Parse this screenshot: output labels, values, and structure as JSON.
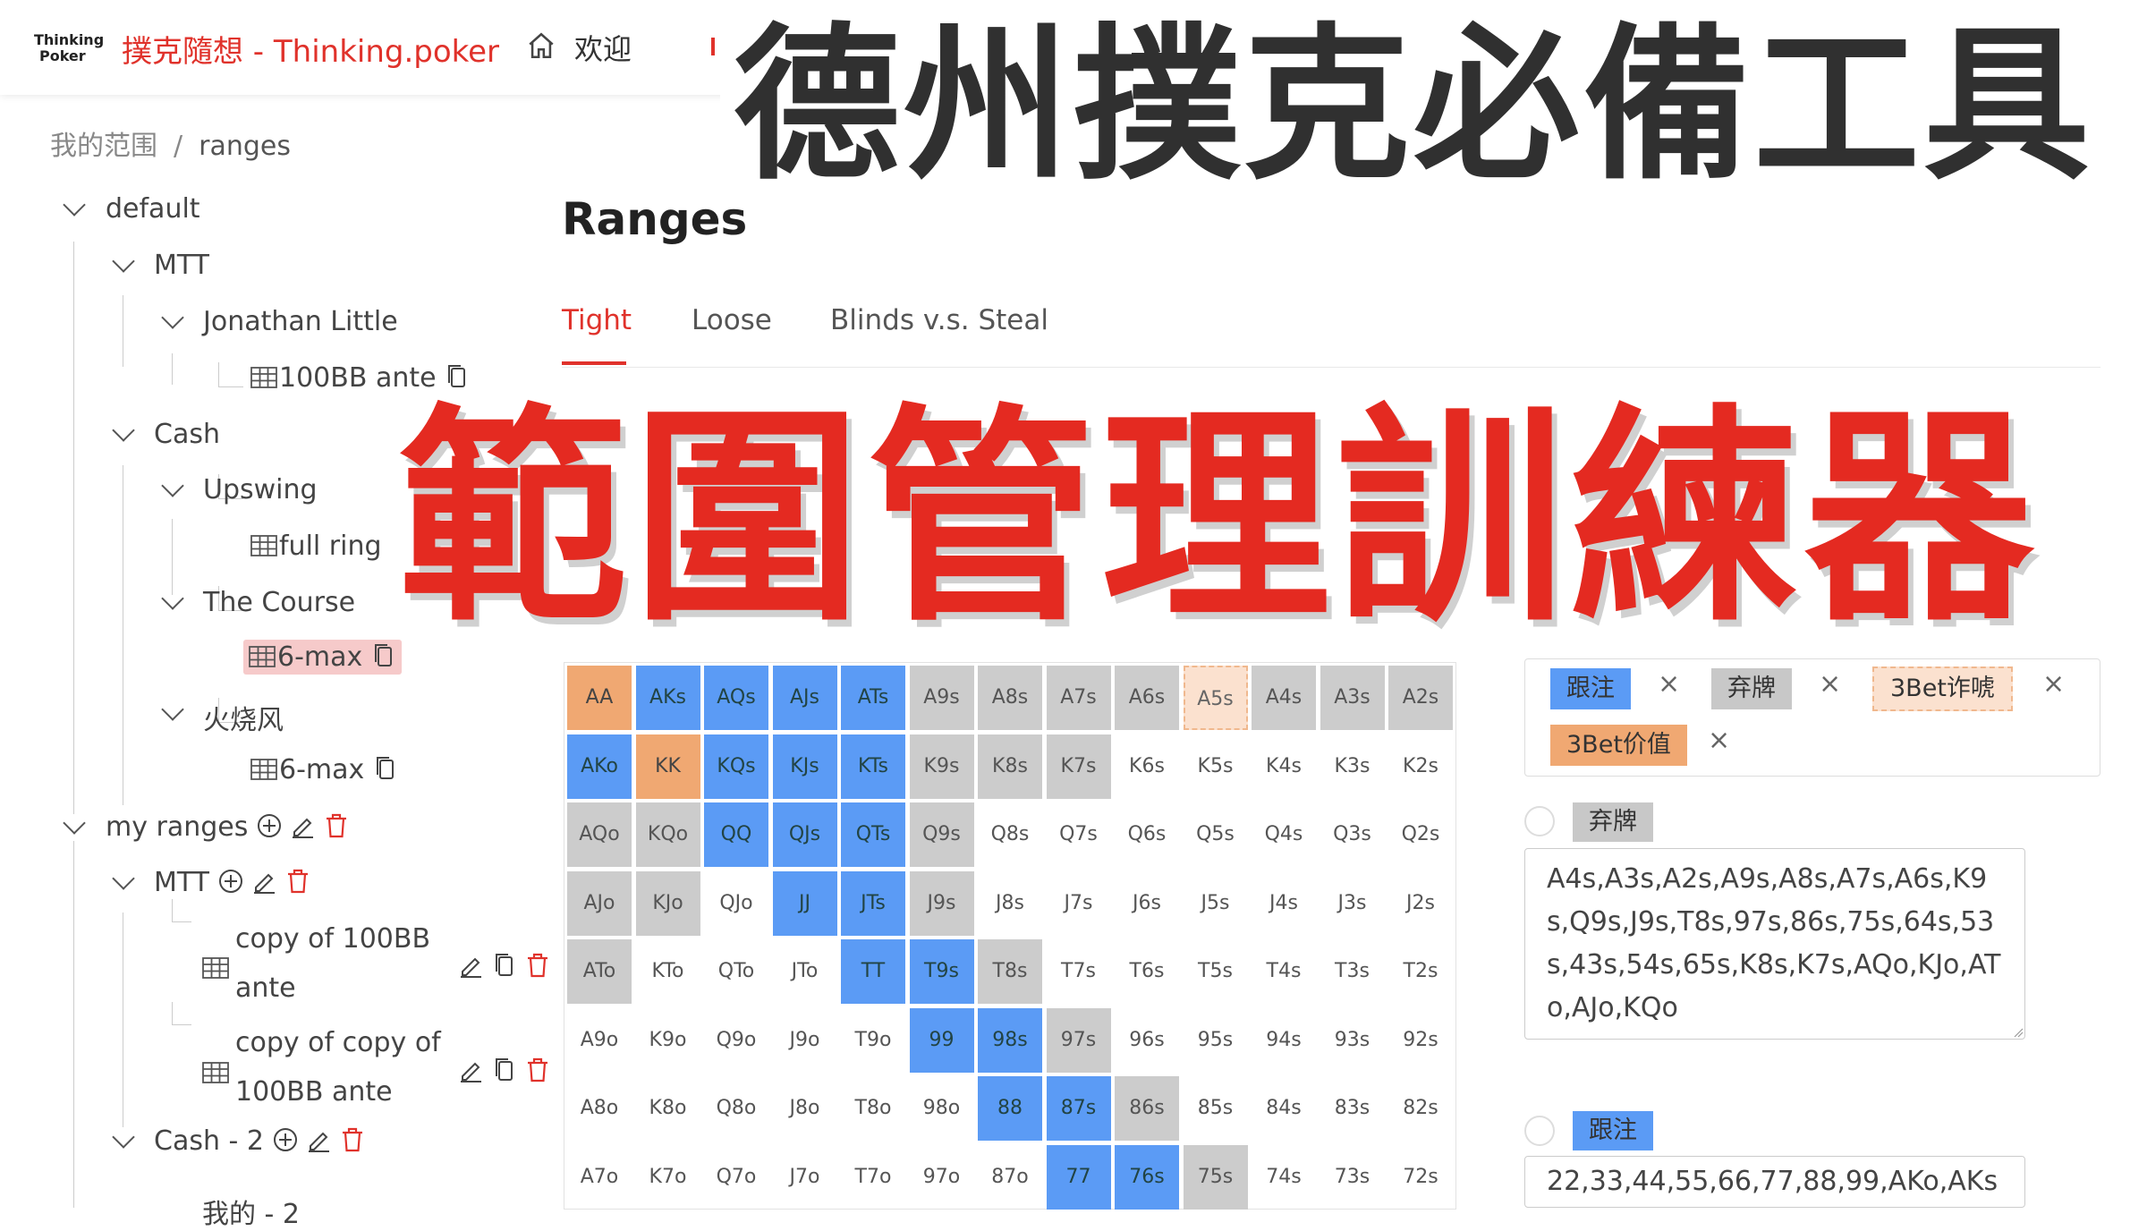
{
  "header": {
    "logo_line1": "Thinking",
    "logo_line2": "Poker",
    "title": "撲克隨想 - Thinking.poker",
    "nav_welcome": "欢迎"
  },
  "breadcrumb": {
    "root": "我的范围",
    "sep": "/",
    "current": "ranges"
  },
  "tree": {
    "default": "default",
    "mtt": "MTT",
    "jonathan": "Jonathan Little",
    "ante100": "100BB ante",
    "cash": "Cash",
    "upswing": "Upswing",
    "fullring": "full ring",
    "course": "The Course",
    "sixmax1": "6-max",
    "huoshao": "火烧风",
    "sixmax2": "6-max",
    "myranges": "my ranges",
    "mtt2": "MTT",
    "copy1_l1": "copy of 100BB",
    "copy1_l2": "ante",
    "copy2_l1": "copy of copy of",
    "copy2_l2": "100BB ante",
    "cash2": "Cash - 2",
    "partial": "我的 - 2"
  },
  "main": {
    "title": "Ranges",
    "tabs": [
      "Tight",
      "Loose",
      "Blinds v.s. Steal"
    ],
    "active_tab": "Tight"
  },
  "range_grid": {
    "rows": [
      [
        "AA",
        "AKs",
        "AQs",
        "AJs",
        "ATs",
        "A9s",
        "A8s",
        "A7s",
        "A6s",
        "A5s",
        "A4s",
        "A3s",
        "A2s"
      ],
      [
        "AKo",
        "KK",
        "KQs",
        "KJs",
        "KTs",
        "K9s",
        "K8s",
        "K7s",
        "K6s",
        "K5s",
        "K4s",
        "K3s",
        "K2s"
      ],
      [
        "AQo",
        "KQo",
        "QQ",
        "QJs",
        "QTs",
        "Q9s",
        "Q8s",
        "Q7s",
        "Q6s",
        "Q5s",
        "Q4s",
        "Q3s",
        "Q2s"
      ],
      [
        "AJo",
        "KJo",
        "QJo",
        "JJ",
        "JTs",
        "J9s",
        "J8s",
        "J7s",
        "J6s",
        "J5s",
        "J4s",
        "J3s",
        "J2s"
      ],
      [
        "ATo",
        "KTo",
        "QTo",
        "JTo",
        "TT",
        "T9s",
        "T8s",
        "T7s",
        "T6s",
        "T5s",
        "T4s",
        "T3s",
        "T2s"
      ],
      [
        "A9o",
        "K9o",
        "Q9o",
        "J9o",
        "T9o",
        "99",
        "98s",
        "97s",
        "96s",
        "95s",
        "94s",
        "93s",
        "92s"
      ],
      [
        "A8o",
        "K8o",
        "Q8o",
        "J8o",
        "T8o",
        "98o",
        "88",
        "87s",
        "86s",
        "85s",
        "84s",
        "83s",
        "82s"
      ],
      [
        "A7o",
        "K7o",
        "Q7o",
        "J7o",
        "T7o",
        "97o",
        "87o",
        "77",
        "76s",
        "75s",
        "74s",
        "73s",
        "72s"
      ]
    ],
    "colors": [
      [
        "orange",
        "blue",
        "blue",
        "blue",
        "blue",
        "gray",
        "gray",
        "gray",
        "gray",
        "light",
        "gray",
        "gray",
        "gray"
      ],
      [
        "blue",
        "orange",
        "blue",
        "blue",
        "blue",
        "gray",
        "gray",
        "gray",
        "none",
        "none",
        "none",
        "none",
        "none"
      ],
      [
        "gray",
        "gray",
        "blue",
        "blue",
        "blue",
        "gray",
        "none",
        "none",
        "none",
        "none",
        "none",
        "none",
        "none"
      ],
      [
        "gray",
        "gray",
        "none",
        "blue",
        "blue",
        "gray",
        "none",
        "none",
        "none",
        "none",
        "none",
        "none",
        "none"
      ],
      [
        "gray",
        "none",
        "none",
        "none",
        "blue",
        "blue",
        "gray",
        "none",
        "none",
        "none",
        "none",
        "none",
        "none"
      ],
      [
        "none",
        "none",
        "none",
        "none",
        "none",
        "blue",
        "blue",
        "gray",
        "none",
        "none",
        "none",
        "none",
        "none"
      ],
      [
        "none",
        "none",
        "none",
        "none",
        "none",
        "none",
        "blue",
        "blue",
        "gray",
        "none",
        "none",
        "none",
        "none"
      ],
      [
        "none",
        "none",
        "none",
        "none",
        "none",
        "none",
        "none",
        "blue",
        "blue",
        "gray",
        "none",
        "none",
        "none"
      ]
    ],
    "palette": {
      "orange": "#f0a872",
      "blue": "#5b9bf5",
      "gray": "#cccccc",
      "light": "#fbe1cf"
    }
  },
  "legend": {
    "call": "跟注",
    "fold": "弃牌",
    "bluff3bet": "3Bet诈唬",
    "value3bet": "3Bet价值",
    "remove": "×"
  },
  "actions": {
    "fold_label": "弃牌",
    "fold_hands": "A4s,A3s,A2s,A9s,A8s,A7s,A6s,K9s,Q9s,J9s,T8s,97s,86s,75s,64s,53s,43s,54s,65s,K8s,K7s,AQo,KJo,ATo,AJo,KQo",
    "call_label": "跟注",
    "call_hands": "22,33,44,55,66,77,88,99,AKo,AKs"
  },
  "overlay": {
    "headline": "德州撲克必備工具",
    "headline2": "範圍管理訓練器"
  },
  "colors": {
    "brand_red": "#e0322b",
    "headline_red": "#e42a21"
  }
}
